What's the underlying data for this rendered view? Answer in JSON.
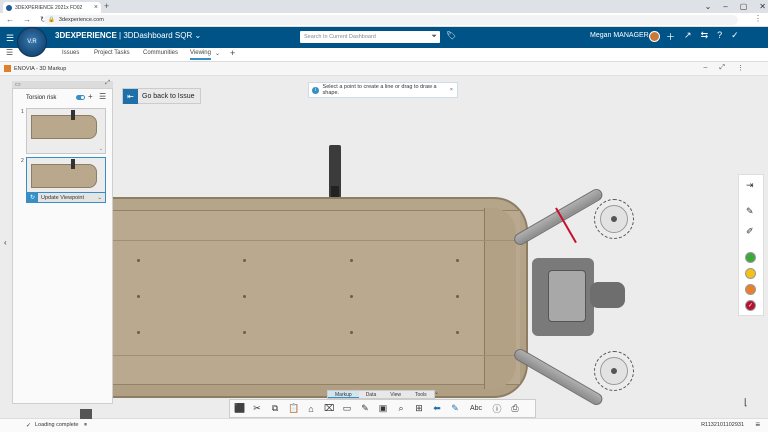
{
  "browser": {
    "tab_title": "3DEXPERIENCE 2021x FD02",
    "url": "3dexperience.com",
    "tab_close": "×",
    "new_tab": "+"
  },
  "header": {
    "brand_bold": "3DEXPERIENCE",
    "brand_rest": " | 3DDashboard SQR",
    "search_placeholder": "Search In Current Dashboard",
    "user_name": "Megan MANAGER",
    "compass_label": "V.R"
  },
  "dashboard_tabs": [
    {
      "label": "Issues"
    },
    {
      "label": "Project Tasks"
    },
    {
      "label": "Communities"
    },
    {
      "label": "Viewing"
    }
  ],
  "app": {
    "title": "ENOVIA - 3D Markup"
  },
  "issue_panel": {
    "title": "Torsion risk",
    "snapshot_1_label": "1",
    "snapshot_2_label": "2",
    "update_viewpoint_label": "Update Viewpoint"
  },
  "viewer": {
    "go_back_label": "Go back to Issue",
    "hint_text": "Select a point to create a line or drag to draw a shape."
  },
  "colors": {
    "green": "#3ea83a",
    "yellow": "#f2c21b",
    "orange": "#e9802c",
    "red": "#b5122f",
    "accent": "#368ec4",
    "topbar": "#005386"
  },
  "bottom_tabs": [
    {
      "label": "Markup"
    },
    {
      "label": "Data"
    },
    {
      "label": "View"
    },
    {
      "label": "Tools"
    }
  ],
  "bottom_toolbar_icons": [
    "screen-capture-icon",
    "cut-icon",
    "copy-icon",
    "paste-icon",
    "home-icon",
    "clear-markup-icon",
    "rectangle-icon",
    "edit-note-icon",
    "view-icon",
    "zoom-icon",
    "fit-all-icon",
    "back-arrow-icon",
    "pen-icon",
    "text-icon",
    "info-icon",
    "print-icon"
  ],
  "bottom_toolbar_text_label": "Abc",
  "status": {
    "message": "Loading complete",
    "record_id": "R1132101102931"
  }
}
